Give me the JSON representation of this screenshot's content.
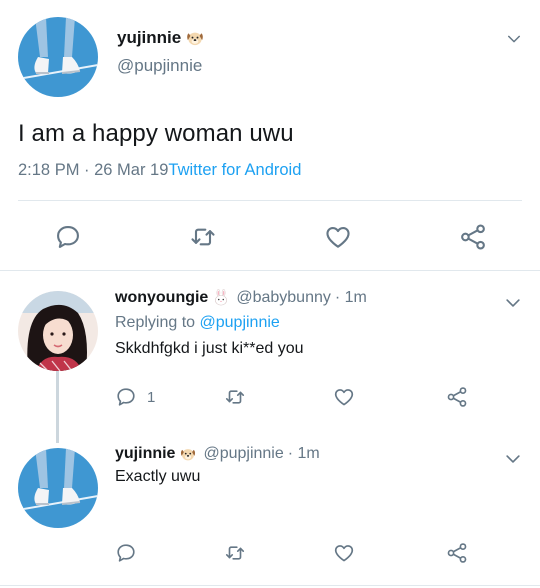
{
  "main_tweet": {
    "display_name": "yujinnie",
    "handle": "@pupjinnie",
    "text": "I am a happy woman uwu",
    "time": "2:18 PM · 26 Mar 19",
    "source": "Twitter for Android"
  },
  "replies": [
    {
      "display_name": "wonyoungie",
      "handle": "@babybunny",
      "time": "· 1m",
      "replying_to_label": "Replying to",
      "replying_to_handle": "@pupjinnie",
      "text": "Skkdhfgkd i just ki**ed you",
      "reply_count": "1"
    },
    {
      "display_name": "yujinnie",
      "handle": "@pupjinnie",
      "time": "· 1m",
      "text": "Exactly uwu"
    }
  ],
  "icons": {
    "reply": "comment-bubble-icon",
    "retweet": "retweet-icon",
    "like": "heart-icon",
    "share": "share-icon",
    "menu": "chevron-down-icon",
    "dog_emoji": "dog-face-emoji",
    "bunny_emoji": "rabbit-face-emoji"
  },
  "colors": {
    "text": "#14171a",
    "secondary": "#657786",
    "accent": "#1da1f2",
    "border": "#e1e8ed"
  }
}
